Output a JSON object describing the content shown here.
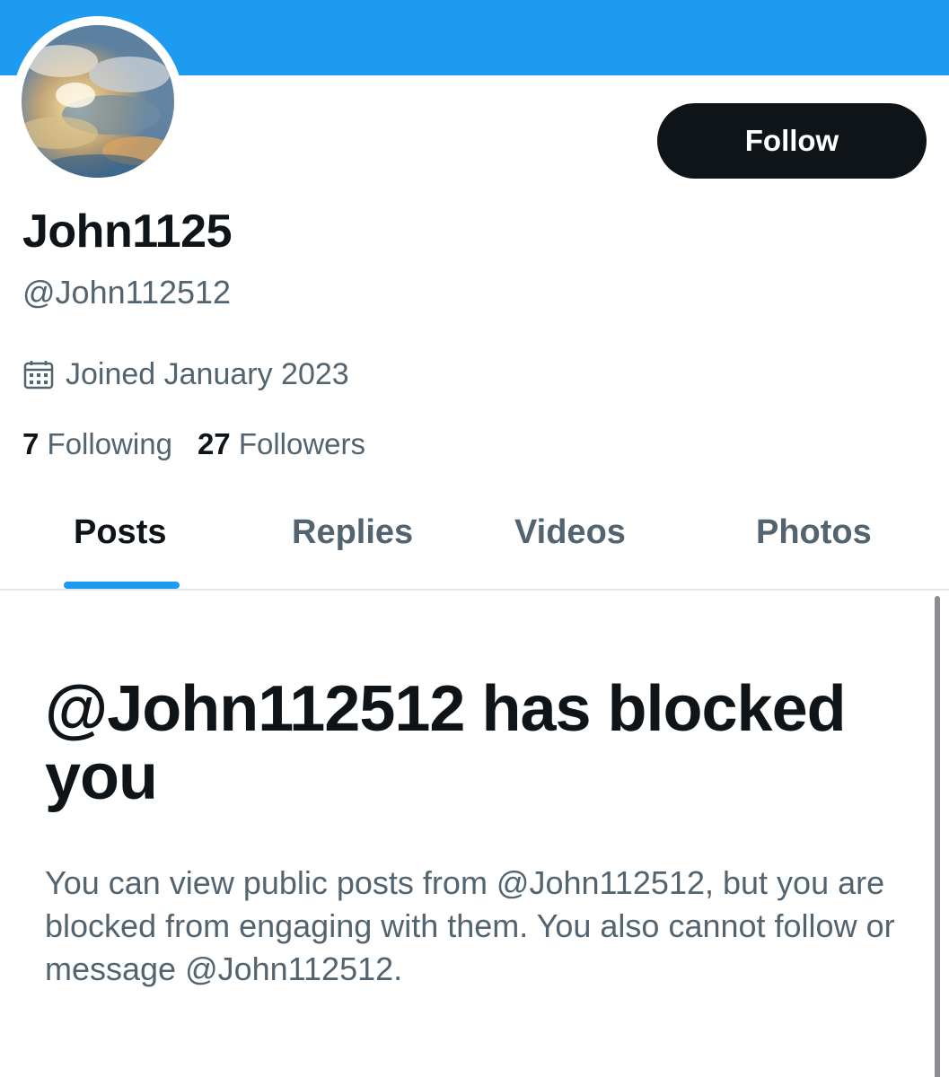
{
  "colors": {
    "banner": "#1d9bf0",
    "accent": "#1d9bf0",
    "primary_text": "#0f1419",
    "secondary_text": "#536471",
    "follow_button_bg": "#0f1419"
  },
  "profile": {
    "display_name": "John1125",
    "handle": "@John112512",
    "avatar_icon": "avatar-image-clouds-sunlight",
    "joined_icon": "calendar-icon",
    "joined": "Joined January 2023",
    "following_count": "7",
    "following_label": "Following",
    "followers_count": "27",
    "followers_label": "Followers"
  },
  "actions": {
    "follow_label": "Follow"
  },
  "tabs": [
    {
      "label": "Posts",
      "active": true
    },
    {
      "label": "Replies",
      "active": false
    },
    {
      "label": "Videos",
      "active": false
    },
    {
      "label": "Photos",
      "active": false
    }
  ],
  "blocked": {
    "title": "@John112512 has blocked you",
    "body": "You can view public posts from @John112512, but you are blocked from engaging with them. You also cannot follow or message @John112512."
  }
}
